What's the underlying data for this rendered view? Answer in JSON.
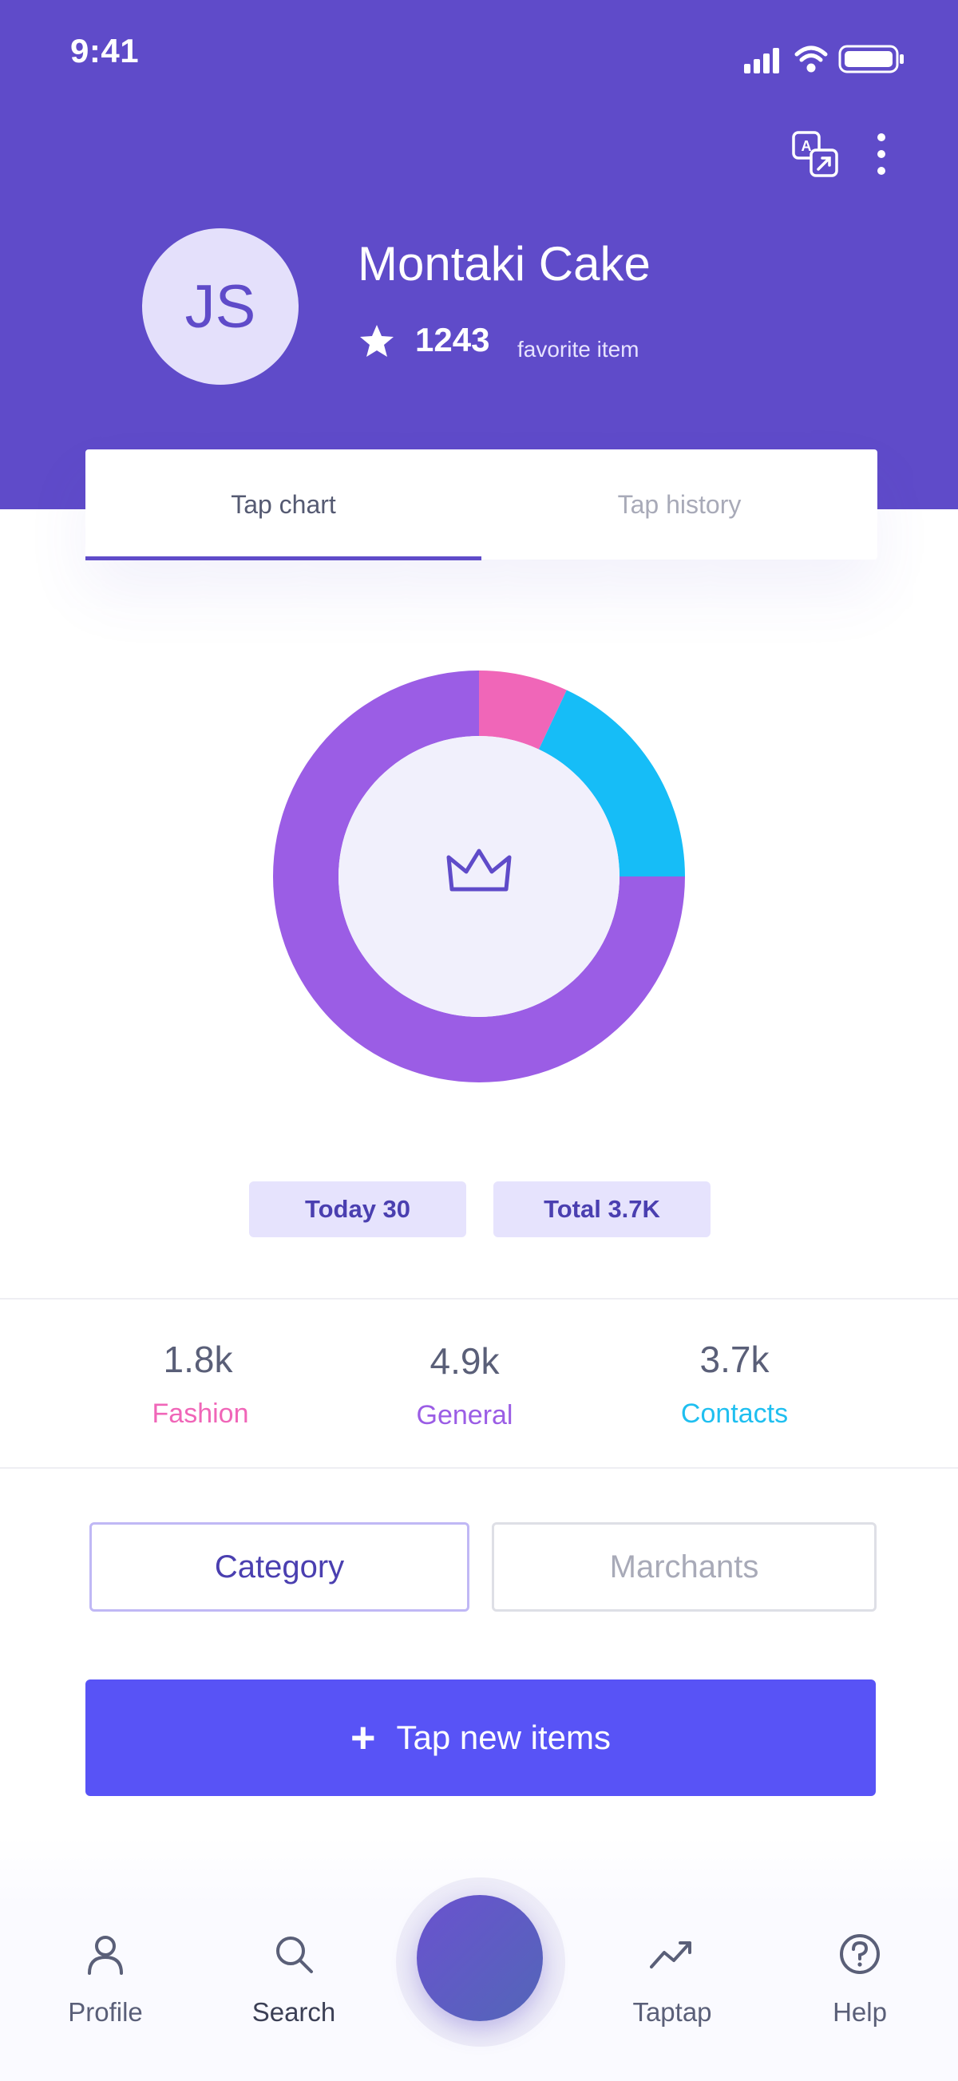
{
  "status_bar": {
    "time": "9:41",
    "icons": [
      "signal-icon",
      "wifi-icon",
      "battery-icon"
    ]
  },
  "header": {
    "actions": [
      "translate-icon",
      "more-icon"
    ],
    "avatar_initials": "JS",
    "shop_name": "Montaki Cake",
    "favorite_count": "1243",
    "favorite_label": "favorite item",
    "background_color": "#5f4bc9"
  },
  "tabs": [
    {
      "label": "Tap chart",
      "active": true
    },
    {
      "label": "Tap history",
      "active": false
    }
  ],
  "chart_data": {
    "type": "pie",
    "style": "donut",
    "center_icon": "crown-icon",
    "slices": [
      {
        "label": "Fashion",
        "fraction": 0.07,
        "color": "#f066b8"
      },
      {
        "label": "Contacts",
        "fraction": 0.18,
        "color": "#16bdf7"
      },
      {
        "label": "General",
        "fraction": 0.75,
        "color": "#9b5de5"
      }
    ]
  },
  "pills": {
    "today": "Today 30",
    "total": "Total 3.7K"
  },
  "stats": [
    {
      "value": "1.8k",
      "label": "Fashion",
      "color": "#f066b8"
    },
    {
      "value": "4.9k",
      "label": "General",
      "color": "#9b5de5"
    },
    {
      "value": "3.7k",
      "label": "Contacts",
      "color": "#1fbff0"
    }
  ],
  "segments": {
    "category": "Category",
    "merchants": "Marchants"
  },
  "cta": {
    "icon": "plus-icon",
    "label": "Tap new items"
  },
  "bottom_nav": [
    {
      "label": "Profile",
      "icon": "profile-icon",
      "color": "#5a5f78"
    },
    {
      "label": "Search",
      "icon": "search-icon",
      "color": "#3b3f55"
    },
    {
      "label": "Taptap",
      "icon": "trend-icon",
      "color": "#5a5f78"
    },
    {
      "label": "Help",
      "icon": "help-icon",
      "color": "#5a5f78"
    }
  ]
}
